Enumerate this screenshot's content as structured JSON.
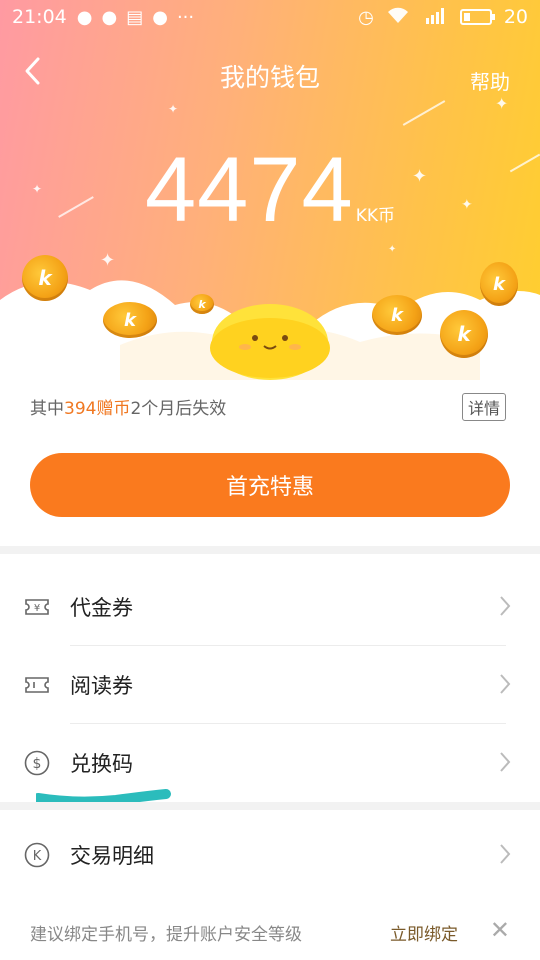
{
  "status": {
    "time": "21:04",
    "battery": "20",
    "network": "4G"
  },
  "header": {
    "title": "我的钱包",
    "help": "帮助"
  },
  "balance": {
    "amount": "4474",
    "unit": "KK币"
  },
  "gift_info": {
    "prefix": "其中",
    "amount": "394赠币",
    "suffix": "2个月后失效",
    "detail": "详情"
  },
  "recharge_button": "首充特惠",
  "menu": [
    {
      "label": "代金券",
      "icon": "voucher-icon"
    },
    {
      "label": "阅读券",
      "icon": "ticket-icon"
    },
    {
      "label": "兑换码",
      "icon": "dollar-circle-icon"
    },
    {
      "label": "交易明细",
      "icon": "k-circle-icon"
    }
  ],
  "bind_bar": {
    "tip": "建议绑定手机号，提升账户安全等级",
    "action": "立即绑定",
    "close": "✕"
  },
  "colors": {
    "accent": "#fa7a1e",
    "highlight": "#f07822",
    "marker": "#2bbcbc"
  }
}
